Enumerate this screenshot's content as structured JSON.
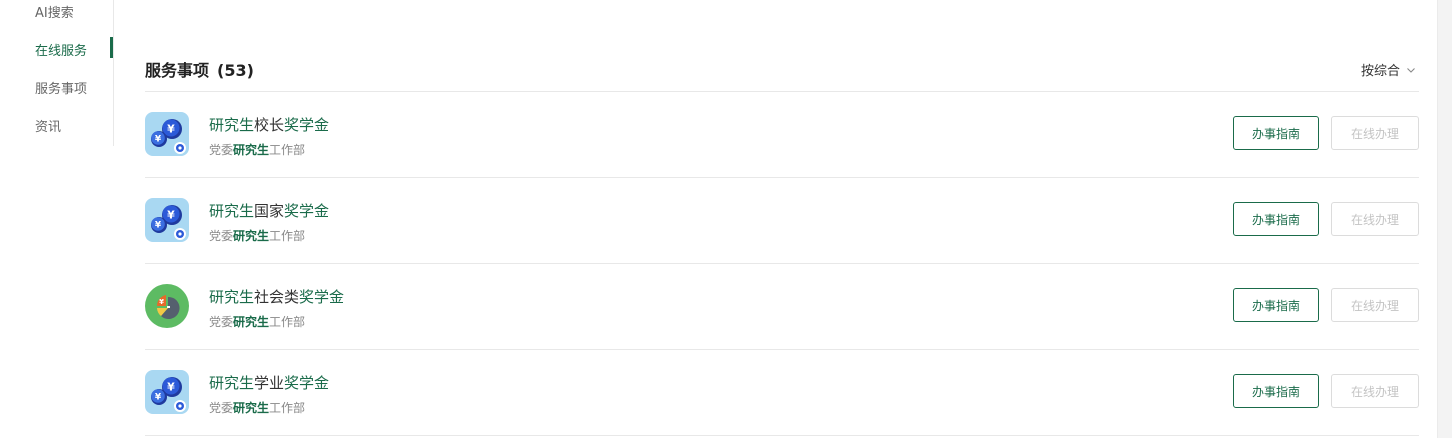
{
  "sidebar": {
    "items": [
      {
        "label": "AI搜索"
      },
      {
        "label": "在线服务"
      },
      {
        "label": "服务事项"
      },
      {
        "label": "资讯"
      }
    ],
    "active_index": 1
  },
  "header": {
    "title": "服务事项",
    "count": "(53)",
    "sort_label": "按综合"
  },
  "colors": {
    "accent": "#1a6b4a",
    "muted": "#888888",
    "disabled": "#c4c4c4"
  },
  "services": [
    {
      "title_prefix": "研究生",
      "title_middle": "校长",
      "title_suffix": "奖学金",
      "dept_prefix": "党委",
      "dept_highlight": "研究生",
      "dept_suffix": "工作部",
      "icon": "coins-gear-icon",
      "guide_label": "办事指南",
      "online_label": "在线办理"
    },
    {
      "title_prefix": "研究生",
      "title_middle": "国家",
      "title_suffix": "奖学金",
      "dept_prefix": "党委",
      "dept_highlight": "研究生",
      "dept_suffix": "工作部",
      "icon": "coins-gear-icon",
      "guide_label": "办事指南",
      "online_label": "在线办理"
    },
    {
      "title_prefix": "研究生",
      "title_middle": "社会类",
      "title_suffix": "奖学金",
      "dept_prefix": "党委",
      "dept_highlight": "研究生",
      "dept_suffix": "工作部",
      "icon": "pie-chart-icon",
      "guide_label": "办事指南",
      "online_label": "在线办理"
    },
    {
      "title_prefix": "研究生",
      "title_middle": "学业",
      "title_suffix": "奖学金",
      "dept_prefix": "党委",
      "dept_highlight": "研究生",
      "dept_suffix": "工作部",
      "icon": "coins-gear-icon",
      "guide_label": "办事指南",
      "online_label": "在线办理"
    }
  ]
}
